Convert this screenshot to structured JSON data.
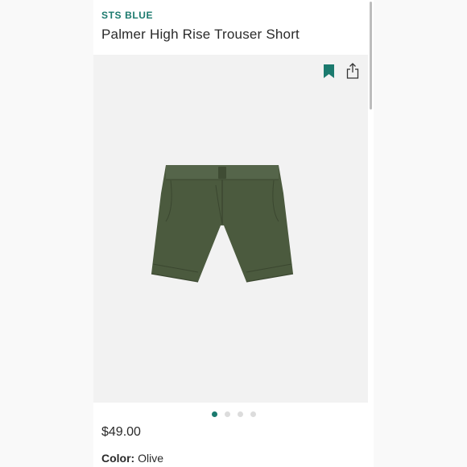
{
  "product": {
    "brand": "STS BLUE",
    "title": "Palmer High Rise Trouser Short",
    "price": "$49.00",
    "color_label": "Color:",
    "color_value": "Olive"
  },
  "gallery": {
    "slide_count": 4,
    "active_slide": 1,
    "product_color": "#4b5a3e"
  },
  "icons": {
    "bookmark": "bookmark-icon",
    "share": "share-icon"
  },
  "theme": {
    "accent": "#1b7a6e",
    "text": "#2a2a2a",
    "image_bg": "#f2f2f2"
  }
}
